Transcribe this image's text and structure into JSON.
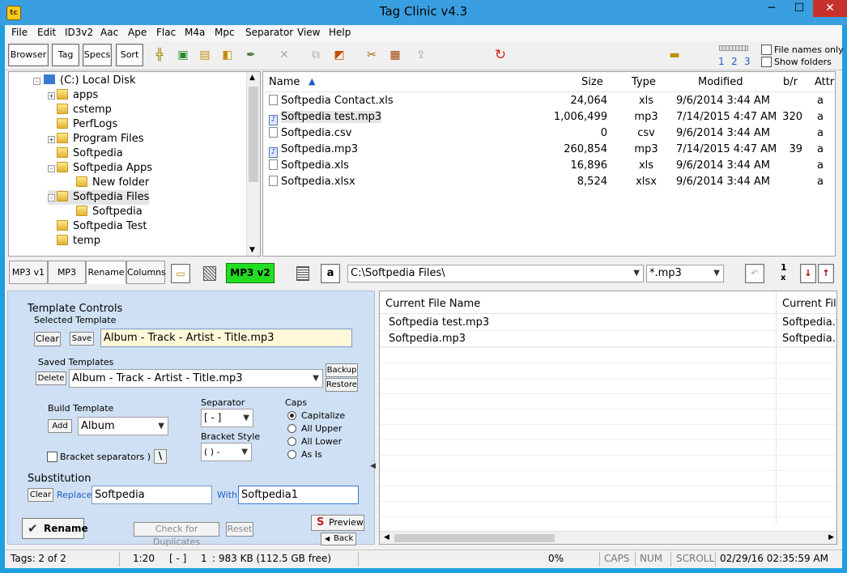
{
  "window": {
    "title": "Tag Clinic v4.3",
    "min": "─",
    "max": "☐",
    "close": "✕"
  },
  "menu": [
    "File",
    "Edit",
    "ID3v2",
    "Aac",
    "Ape",
    "Flac",
    "M4a",
    "Mpc",
    "Separator",
    "View",
    "Help"
  ],
  "toolbar": {
    "browser": "Browser",
    "tag": "Tag",
    "specs": "Specs",
    "sort": "Sort",
    "pages": [
      "1",
      "2",
      "3"
    ],
    "file_names_only": "File names only",
    "show_folders": "Show folders"
  },
  "tree": {
    "root": "(C:)  Local Disk",
    "items": [
      {
        "label": "apps",
        "indent": 1,
        "expand": "+"
      },
      {
        "label": "cstemp",
        "indent": 1,
        "expand": ""
      },
      {
        "label": "PerfLogs",
        "indent": 1,
        "expand": ""
      },
      {
        "label": "Program Files",
        "indent": 1,
        "expand": "+"
      },
      {
        "label": "Softpedia",
        "indent": 1,
        "expand": ""
      },
      {
        "label": "Softpedia Apps",
        "indent": 1,
        "expand": "-"
      },
      {
        "label": "New folder",
        "indent": 2,
        "expand": ""
      },
      {
        "label": "Softpedia Files",
        "indent": 1,
        "expand": "-"
      },
      {
        "label": "Softpedia",
        "indent": 2,
        "expand": ""
      },
      {
        "label": "Softpedia Test",
        "indent": 1,
        "expand": ""
      },
      {
        "label": "temp",
        "indent": 1,
        "expand": ""
      }
    ]
  },
  "files": {
    "columns": [
      "Name",
      "Size",
      "Type",
      "Modified",
      "b/r",
      "Attr"
    ],
    "rows": [
      {
        "name": "Softpedia Contact.xls",
        "size": "24,064",
        "type": "xls",
        "modified": "9/6/2014 3:44 AM",
        "br": "",
        "attr": "a",
        "icon": "doc"
      },
      {
        "name": "Softpedia test.mp3",
        "size": "1,006,499",
        "type": "mp3",
        "modified": "7/14/2015 4:47 AM",
        "br": "320",
        "attr": "a",
        "icon": "music"
      },
      {
        "name": "Softpedia.csv",
        "size": "0",
        "type": "csv",
        "modified": "9/6/2014 3:44 AM",
        "br": "",
        "attr": "a",
        "icon": "doc"
      },
      {
        "name": "Softpedia.mp3",
        "size": "260,854",
        "type": "mp3",
        "modified": "7/14/2015 4:47 AM",
        "br": "39",
        "attr": "a",
        "icon": "music"
      },
      {
        "name": "Softpedia.xls",
        "size": "16,896",
        "type": "xls",
        "modified": "9/6/2014 3:44 AM",
        "br": "",
        "attr": "a",
        "icon": "doc"
      },
      {
        "name": "Softpedia.xlsx",
        "size": "8,524",
        "type": "xlsx",
        "modified": "9/6/2014 3:44 AM",
        "br": "",
        "attr": "a",
        "icon": "doc"
      }
    ]
  },
  "midbar": {
    "tabs": [
      "MP3 v1",
      "MP3",
      "Rename",
      "Columns"
    ],
    "mp3v2": "MP3 v2",
    "a_button": "a",
    "path": "C:\\Softpedia Files\\",
    "filter": "*.mp3",
    "count_top": "1",
    "count_bottom": "x"
  },
  "template": {
    "group": "Template Controls",
    "selected_label": "Selected Template",
    "clear": "Clear",
    "save": "Save",
    "selected_value": "Album - Track - Artist - Title.mp3",
    "saved_label": "Saved Templates",
    "delete": "Delete",
    "saved_value": "Album - Track - Artist - Title.mp3",
    "backup": "Backup",
    "restore": "Restore",
    "build_label": "Build Template",
    "add": "Add",
    "build_value": "Album",
    "separator_label": "Separator",
    "separator_value": "[  -  ]",
    "bracket_label": "Bracket Style",
    "bracket_value": "( ) -",
    "caps_label": "Caps",
    "caps_options": [
      "Capitalize",
      "All Upper",
      "All Lower",
      "As Is"
    ],
    "caps_selected": 0,
    "bracket_separators": "Bracket separators ) - (",
    "backslash": "\\"
  },
  "substitution": {
    "label": "Substitution",
    "clear": "Clear",
    "replace_label": "Replace:",
    "replace_value": "Softpedia",
    "with_label": "With:",
    "with_value": "Softpedia1"
  },
  "actions": {
    "rename": "Rename",
    "check_duplicates": "Check for Duplicates",
    "reset": "Reset",
    "preview": "Preview",
    "back": "Back"
  },
  "rename_list": {
    "columns": [
      "Current File Name",
      "Current File"
    ],
    "rows": [
      [
        "Softpedia test.mp3",
        "Softpedia.t"
      ],
      [
        "Softpedia.mp3",
        "Softpedia.r"
      ]
    ]
  },
  "status": {
    "tags": "Tags: 2 of 2",
    "time": "1:20",
    "sep": "[  -  ]",
    "count": "1",
    "size": ":  983 KB  (112.5 GB free)",
    "percent": "0%",
    "caps": "CAPS",
    "num": "NUM",
    "scroll": "SCROLL",
    "datetime": "02/29/16 02:35:59 AM"
  }
}
